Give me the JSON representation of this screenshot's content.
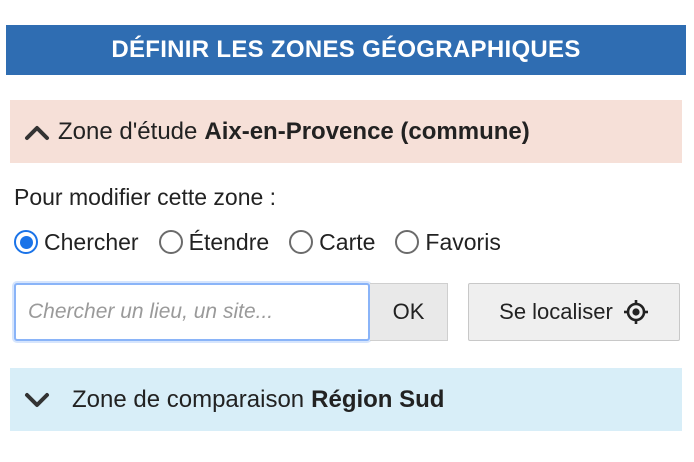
{
  "header": {
    "title": "DÉFINIR LES ZONES GÉOGRAPHIQUES"
  },
  "zone_etude": {
    "label": "Zone d'étude",
    "name": "Aix-en-Provence (commune)",
    "icon": "chevron-up-icon",
    "background": "#f6e0d8"
  },
  "instruction": "Pour modifier cette zone :",
  "radios": [
    {
      "label": "Chercher",
      "checked": true
    },
    {
      "label": "Étendre",
      "checked": false
    },
    {
      "label": "Carte",
      "checked": false
    },
    {
      "label": "Favoris",
      "checked": false
    }
  ],
  "search": {
    "placeholder": "Chercher un lieu, un site...",
    "value": ""
  },
  "ok_label": "OK",
  "locate": {
    "label": "Se localiser",
    "icon": "crosshair-icon"
  },
  "zone_comparaison": {
    "label": "Zone de comparaison",
    "name": "Région Sud",
    "icon": "chevron-down-icon",
    "background": "#d8eef8"
  },
  "colors": {
    "header_bg": "#2f6db2",
    "radio_accent": "#1a73e8"
  }
}
